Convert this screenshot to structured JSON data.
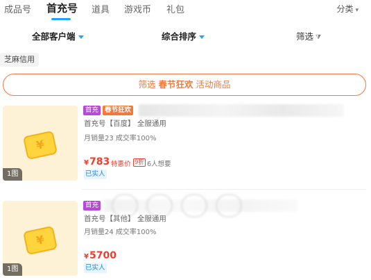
{
  "tabs": [
    {
      "label": "成品号"
    },
    {
      "label": "首充号"
    },
    {
      "label": "道具"
    },
    {
      "label": "游戏币"
    },
    {
      "label": "礼包"
    }
  ],
  "category": {
    "label": "分类"
  },
  "filters": {
    "client": "全部客户端",
    "sort": "综合排序",
    "screen": "筛选"
  },
  "chip": {
    "label": "芝麻信用"
  },
  "banner": {
    "prefix": "筛选",
    "highlight": "春节狂欢",
    "suffix": "活动商品"
  },
  "products": [
    {
      "tags": [
        "首充",
        "春节狂欢"
      ],
      "desc": "首充号【百度】 全服通用",
      "sales": "月销量23 成交率100%",
      "currency": "¥",
      "price": "783",
      "discount_label": "特惠价",
      "discount_box": "9折",
      "wants": "6人想要",
      "verified": "已实人",
      "image_count": "1图"
    },
    {
      "tags": [
        "首充"
      ],
      "desc": "首充号【其他】 全服通用",
      "sales": "月销量24 成交率100%",
      "currency": "¥",
      "price": "5700",
      "verified": "已实人",
      "image_count": "1图"
    }
  ],
  "colors": {
    "accent": "#1fa3ff",
    "price": "#f23c2e",
    "banner": "#f07a3c",
    "tag_purple": "#b44bd6"
  }
}
